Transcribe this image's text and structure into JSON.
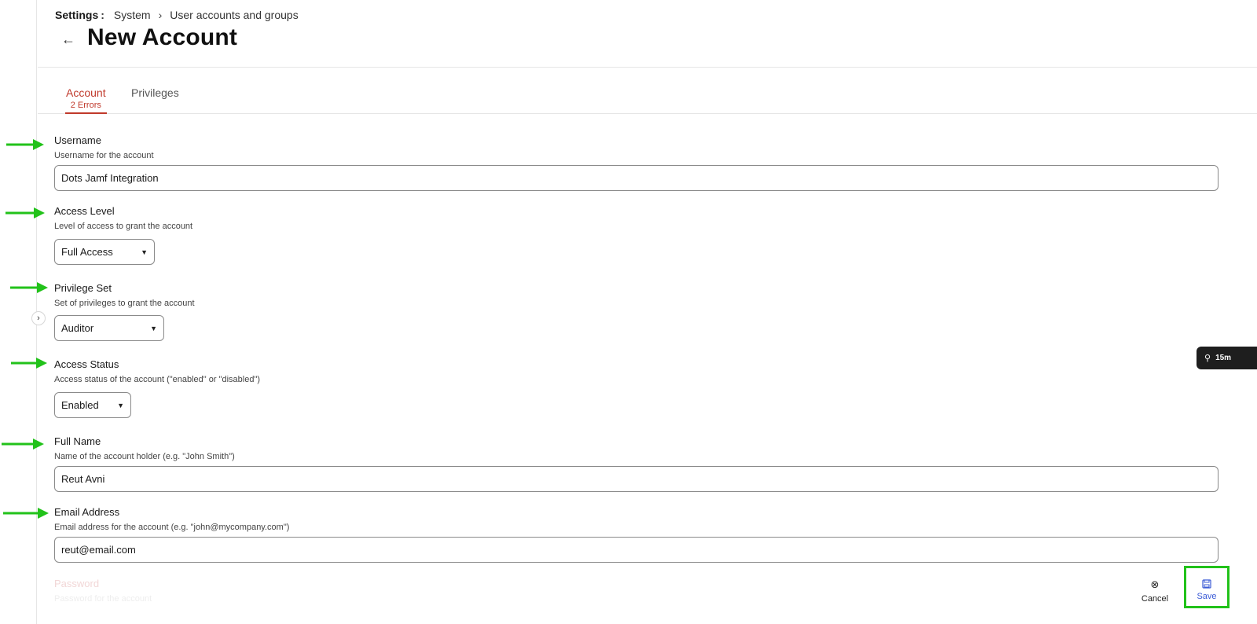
{
  "breadcrumb": {
    "root": "Settings",
    "colon": ":",
    "items": [
      "System",
      "User accounts and groups"
    ]
  },
  "page": {
    "title": "New Account"
  },
  "tabs": [
    {
      "label": "Account",
      "error": "2 Errors"
    },
    {
      "label": "Privileges"
    }
  ],
  "fields": {
    "username": {
      "label": "Username",
      "description": "Username for the account",
      "value": "Dots Jamf Integration"
    },
    "access_level": {
      "label": "Access Level",
      "description": "Level of access to grant the account",
      "value": "Full Access"
    },
    "privilege_set": {
      "label": "Privilege Set",
      "description": "Set of privileges to grant the account",
      "value": "Auditor"
    },
    "access_status": {
      "label": "Access Status",
      "description": "Access status of the account (\"enabled\" or \"disabled\")",
      "value": "Enabled"
    },
    "full_name": {
      "label": "Full Name",
      "description": "Name of the account holder (e.g. \"John Smith\")",
      "value": "Reut Avni"
    },
    "email": {
      "label": "Email Address",
      "description": "Email address for the account (e.g. \"john@mycompany.com\")",
      "value": "reut@email.com"
    },
    "password": {
      "label": "Password",
      "description": "Password for the account"
    }
  },
  "actions": {
    "cancel": "Cancel",
    "save": "Save"
  },
  "floating_pill": {
    "label": "15m"
  },
  "colors": {
    "error": "#c0392b",
    "annotation": "#22c21a",
    "save": "#3b5bd6"
  },
  "icons": {
    "back": "arrow-left-icon",
    "breadcrumb_sep": "chevron-right-icon",
    "select_caret": "caret-down-icon",
    "cancel": "circle-x-icon",
    "save": "floppy-disk-icon",
    "rail_toggle": "chevron-right-icon",
    "annotation": "green-arrow-icon"
  }
}
